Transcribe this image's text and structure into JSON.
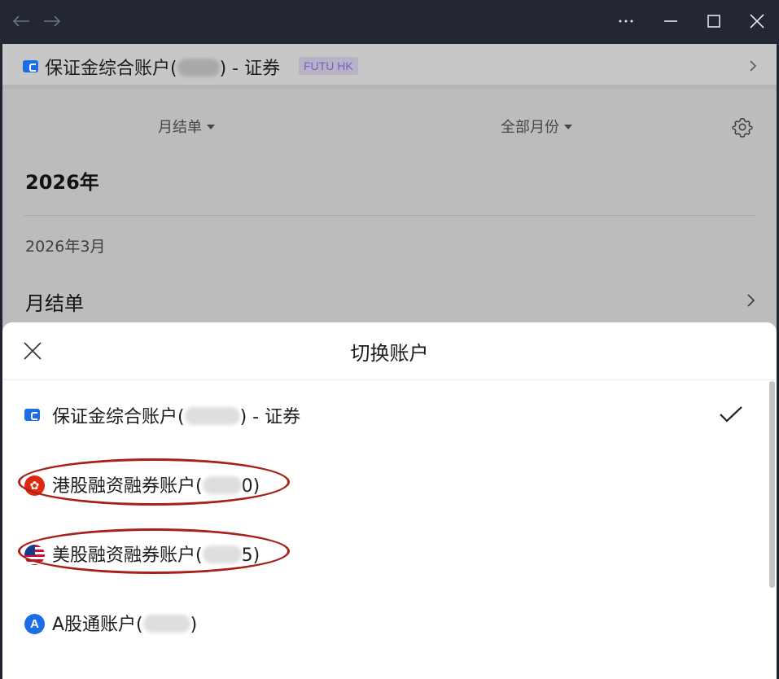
{
  "colors": {
    "accent": "#1c6de8",
    "annotation": "#a8201a",
    "futu_badge": "#7b5fc0"
  },
  "window": {
    "back_icon": "arrow-left-icon",
    "forward_icon": "arrow-right-icon",
    "more_icon": "more-icon",
    "minimize_icon": "minimize-icon",
    "maximize_icon": "maximize-icon",
    "close_icon": "close-icon"
  },
  "account_bar": {
    "title_prefix": "保证金综合账户(",
    "title_suffix": ") - 证券",
    "badge": "FUTU HK"
  },
  "filters": {
    "statement_type": "月结单",
    "month_range": "全部月份"
  },
  "statement_list": {
    "year": "2026年",
    "month": "2026年3月",
    "item": "月结单"
  },
  "switch_sheet": {
    "title": "切换账户",
    "accounts": [
      {
        "prefix": "保证金综合账户(",
        "suffix": ") - 证券",
        "icon": "wallet-icon",
        "selected": true
      },
      {
        "prefix": "港股融资融券账户(",
        "suffix": "0)",
        "icon": "hk-flag-icon",
        "selected": false
      },
      {
        "prefix": "美股融资融券账户(",
        "suffix": "5)",
        "icon": "us-flag-icon",
        "selected": false
      },
      {
        "prefix": "A股通账户(",
        "suffix": ")",
        "icon": "a-share-icon",
        "selected": false
      }
    ]
  }
}
